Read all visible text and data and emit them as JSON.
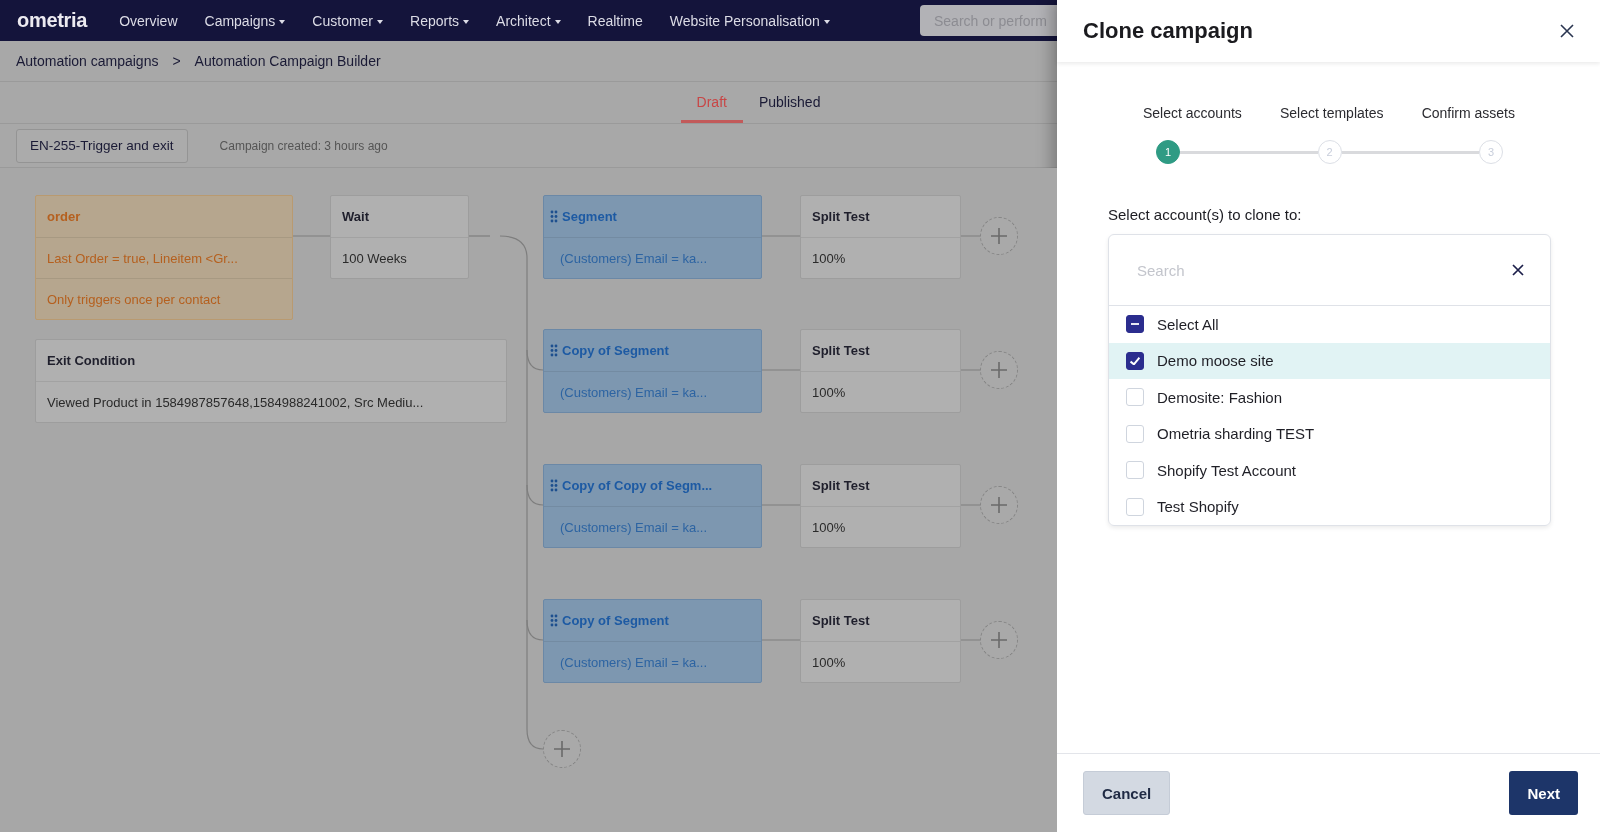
{
  "nav": {
    "logo": "ometria",
    "items": [
      {
        "label": "Overview",
        "dropdown": false
      },
      {
        "label": "Campaigns",
        "dropdown": true
      },
      {
        "label": "Customer",
        "dropdown": true
      },
      {
        "label": "Reports",
        "dropdown": true
      },
      {
        "label": "Architect",
        "dropdown": true
      },
      {
        "label": "Realtime",
        "dropdown": false
      },
      {
        "label": "Website Personalisation",
        "dropdown": true
      }
    ],
    "search": {
      "placeholder": "Search or perform"
    }
  },
  "breadcrumb": [
    "Automation campaigns",
    "Automation Campaign Builder"
  ],
  "breadcrumb_separator": ">",
  "tabs": [
    {
      "label": "Draft",
      "selected": true
    },
    {
      "label": "Published",
      "selected": false
    }
  ],
  "campaign": {
    "name": "EN-255-Trigger and exit",
    "created": "Campaign created: 3 hours ago"
  },
  "canvas": {
    "trigger": {
      "title": "order",
      "lines": [
        "Last Order = true, Lineitem <Gr...",
        "Only triggers once per contact"
      ]
    },
    "wait": {
      "title": "Wait",
      "value": "100 Weeks"
    },
    "exit": {
      "title": "Exit Condition",
      "value": "Viewed Product in 1584987857648,1584988241002, Src Mediu..."
    },
    "branches": [
      {
        "segment": {
          "title": "Segment",
          "value": "(Customers) Email = ka..."
        },
        "split": {
          "title": "Split Test",
          "value": "100%"
        }
      },
      {
        "segment": {
          "title": "Copy of Segment",
          "value": "(Customers) Email = ka..."
        },
        "split": {
          "title": "Split Test",
          "value": "100%"
        }
      },
      {
        "segment": {
          "title": "Copy of Copy of Segm...",
          "value": "(Customers) Email = ka..."
        },
        "split": {
          "title": "Split Test",
          "value": "100%"
        }
      },
      {
        "segment": {
          "title": "Copy of Segment",
          "value": "(Customers) Email = ka..."
        },
        "split": {
          "title": "Split Test",
          "value": "100%"
        }
      }
    ]
  },
  "modal": {
    "title": "Clone campaign",
    "steps": [
      {
        "label": "Select accounts",
        "number": "1",
        "selected": true
      },
      {
        "label": "Select templates",
        "number": "2",
        "selected": false
      },
      {
        "label": "Confirm assets",
        "number": "3",
        "selected": false
      }
    ],
    "prompt": "Select account(s) to clone to:",
    "search": {
      "placeholder": "Search"
    },
    "select_all": {
      "label": "Select All",
      "checked": true,
      "indeterminate": true
    },
    "accounts": [
      {
        "label": "Demo moose site",
        "checked": true,
        "selected": true
      },
      {
        "label": "Demosite: Fashion",
        "checked": false,
        "selected": false
      },
      {
        "label": "Ometria sharding TEST",
        "checked": false,
        "selected": false
      },
      {
        "label": "Shopify Test Account",
        "checked": false,
        "selected": false
      },
      {
        "label": "Test Shopify",
        "checked": false,
        "selected": false
      }
    ],
    "buttons": {
      "cancel": "Cancel",
      "next": "Next"
    }
  }
}
